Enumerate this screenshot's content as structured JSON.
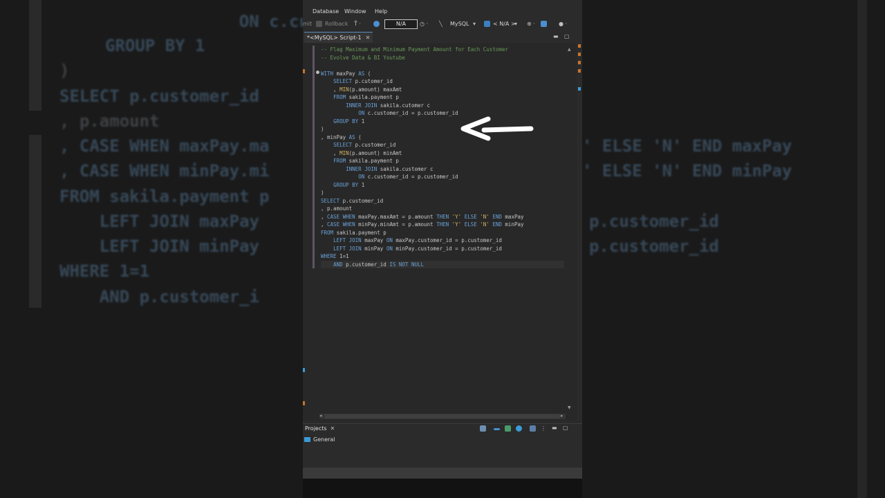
{
  "background_ghost": {
    "lines": [
      {
        "text": "    ON c.cust",
        "cls": "k"
      },
      {
        "text": "GROUP BY 1",
        "cls": "k"
      },
      {
        "text": ")",
        "cls": "g"
      },
      {
        "text": "SELECT p.customer_id",
        "cls": "k"
      },
      {
        "text": ", p.amount",
        "cls": "g"
      },
      {
        "text": ", CASE WHEN maxPay.ma",
        "cls": "k"
      },
      {
        "text": ", CASE WHEN minPay.mi",
        "cls": "k"
      },
      {
        "text": "FROM sakila.payment p",
        "cls": "k"
      },
      {
        "text": "    LEFT JOIN maxPay",
        "cls": "k"
      },
      {
        "text": "    LEFT JOIN minPay",
        "cls": "k"
      },
      {
        "text": "WHERE 1=1",
        "cls": "k"
      },
      {
        "text": "    AND p.customer_i",
        "cls": "k"
      }
    ],
    "right_lines": [
      {
        "text": "' ELSE 'N' END maxPay",
        "cls": "k"
      },
      {
        "text": "' ELSE 'N' END minPay",
        "cls": "k"
      },
      {
        "text": "p.customer_id",
        "cls": "k"
      },
      {
        "text": "p.customer_id",
        "cls": "k"
      }
    ]
  },
  "menu": {
    "items": [
      "Database",
      "Window",
      "Help"
    ]
  },
  "toolbar": {
    "commit_fragment": "mit",
    "rollback": "Rollback",
    "na_box": "N/A",
    "db_type": "MySQL",
    "schema": "< N/A >"
  },
  "editor_tab": {
    "label": "*<MySQL> Script-1",
    "close": "✕"
  },
  "code_lines": [
    [
      {
        "t": "-- Flag Maximum and Minimum Payment Amount for Each Customer",
        "c": "cm"
      }
    ],
    [
      {
        "t": "-- Evolve Data & BI Youtube",
        "c": "cm"
      }
    ],
    [
      {
        "t": "",
        "c": ""
      }
    ],
    [
      {
        "t": "WITH",
        "c": "kw"
      },
      {
        "t": " maxPay ",
        "c": ""
      },
      {
        "t": "AS",
        "c": "kw"
      },
      {
        "t": " (",
        "c": ""
      }
    ],
    [
      {
        "t": "    ",
        "c": ""
      },
      {
        "t": "SELECT",
        "c": "kw"
      },
      {
        "t": " p.cutomer_id",
        "c": ""
      }
    ],
    [
      {
        "t": "    , ",
        "c": ""
      },
      {
        "t": "MIN",
        "c": "fn"
      },
      {
        "t": "(p.amount) maxAmt",
        "c": ""
      }
    ],
    [
      {
        "t": "    ",
        "c": ""
      },
      {
        "t": "FROM",
        "c": "kw"
      },
      {
        "t": " sakila.payment p",
        "c": ""
      }
    ],
    [
      {
        "t": "        ",
        "c": ""
      },
      {
        "t": "INNER JOIN",
        "c": "kw"
      },
      {
        "t": " sakila.cutomer c",
        "c": ""
      }
    ],
    [
      {
        "t": "            ",
        "c": ""
      },
      {
        "t": "ON",
        "c": "kw"
      },
      {
        "t": " c.customer_id = p.customer_id",
        "c": ""
      }
    ],
    [
      {
        "t": "    ",
        "c": ""
      },
      {
        "t": "GROUP BY",
        "c": "kw"
      },
      {
        "t": " 1",
        "c": ""
      }
    ],
    [
      {
        "t": ")",
        "c": ""
      }
    ],
    [
      {
        "t": ", minPay ",
        "c": ""
      },
      {
        "t": "AS",
        "c": "kw"
      },
      {
        "t": " (",
        "c": ""
      }
    ],
    [
      {
        "t": "    ",
        "c": ""
      },
      {
        "t": "SELECT",
        "c": "kw"
      },
      {
        "t": " p.customer_id",
        "c": ""
      }
    ],
    [
      {
        "t": "    , ",
        "c": ""
      },
      {
        "t": "MIN",
        "c": "fn"
      },
      {
        "t": "(p.amount) minAmt",
        "c": ""
      }
    ],
    [
      {
        "t": "    ",
        "c": ""
      },
      {
        "t": "FROM",
        "c": "kw"
      },
      {
        "t": " sakila.payment p",
        "c": ""
      }
    ],
    [
      {
        "t": "        ",
        "c": ""
      },
      {
        "t": "INNER JOIN",
        "c": "kw"
      },
      {
        "t": " sakila.customer c",
        "c": ""
      }
    ],
    [
      {
        "t": "            ",
        "c": ""
      },
      {
        "t": "ON",
        "c": "kw"
      },
      {
        "t": " c.customer_id = p.customer_id",
        "c": ""
      }
    ],
    [
      {
        "t": "    ",
        "c": ""
      },
      {
        "t": "GROUP BY",
        "c": "kw"
      },
      {
        "t": " 1",
        "c": ""
      }
    ],
    [
      {
        "t": ")",
        "c": ""
      }
    ],
    [
      {
        "t": "SELECT",
        "c": "kw"
      },
      {
        "t": " p.customer_id",
        "c": ""
      }
    ],
    [
      {
        "t": ", p.amount",
        "c": ""
      }
    ],
    [
      {
        "t": ", ",
        "c": ""
      },
      {
        "t": "CASE WHEN",
        "c": "kw"
      },
      {
        "t": " maxPay.maxAmt = p.amount ",
        "c": ""
      },
      {
        "t": "THEN",
        "c": "kw"
      },
      {
        "t": " ",
        "c": ""
      },
      {
        "t": "'Y'",
        "c": "str"
      },
      {
        "t": " ",
        "c": ""
      },
      {
        "t": "ELSE",
        "c": "kw"
      },
      {
        "t": " ",
        "c": ""
      },
      {
        "t": "'N'",
        "c": "str"
      },
      {
        "t": " ",
        "c": ""
      },
      {
        "t": "END",
        "c": "kw"
      },
      {
        "t": " maxPay",
        "c": ""
      }
    ],
    [
      {
        "t": ", ",
        "c": ""
      },
      {
        "t": "CASE WHEN",
        "c": "kw"
      },
      {
        "t": " minPay.minAmt = p.amount ",
        "c": ""
      },
      {
        "t": "THEN",
        "c": "kw"
      },
      {
        "t": " ",
        "c": ""
      },
      {
        "t": "'Y'",
        "c": "str"
      },
      {
        "t": " ",
        "c": ""
      },
      {
        "t": "ELSE",
        "c": "kw"
      },
      {
        "t": " ",
        "c": ""
      },
      {
        "t": "'N'",
        "c": "str"
      },
      {
        "t": " ",
        "c": ""
      },
      {
        "t": "END",
        "c": "kw"
      },
      {
        "t": " minPay",
        "c": ""
      }
    ],
    [
      {
        "t": "FROM",
        "c": "kw"
      },
      {
        "t": " sakila.payment p",
        "c": ""
      }
    ],
    [
      {
        "t": "    ",
        "c": ""
      },
      {
        "t": "LEFT JOIN",
        "c": "kw"
      },
      {
        "t": " maxPay ",
        "c": ""
      },
      {
        "t": "ON",
        "c": "kw"
      },
      {
        "t": " maxPay.customer_id = p.customer_id",
        "c": ""
      }
    ],
    [
      {
        "t": "    ",
        "c": ""
      },
      {
        "t": "LEFT JOIN",
        "c": "kw"
      },
      {
        "t": " minPay ",
        "c": ""
      },
      {
        "t": "ON",
        "c": "kw"
      },
      {
        "t": " minPay.customer_id = p.customer_id",
        "c": ""
      }
    ],
    [
      {
        "t": "WHERE",
        "c": "kw"
      },
      {
        "t": " 1=1",
        "c": ""
      }
    ],
    [
      {
        "t": "    ",
        "c": ""
      },
      {
        "t": "AND",
        "c": "kw"
      },
      {
        "t": " p.customer_id ",
        "c": ""
      },
      {
        "t": "IS NOT NULL",
        "c": "kw"
      }
    ]
  ],
  "projects_panel": {
    "tab_label": "Projects",
    "close": "✕",
    "tree_item": "General"
  },
  "colors": {
    "keyword": "#6aa2d8",
    "comment": "#6a9a59",
    "function": "#d4b560",
    "accent": "#3c9bd6"
  }
}
